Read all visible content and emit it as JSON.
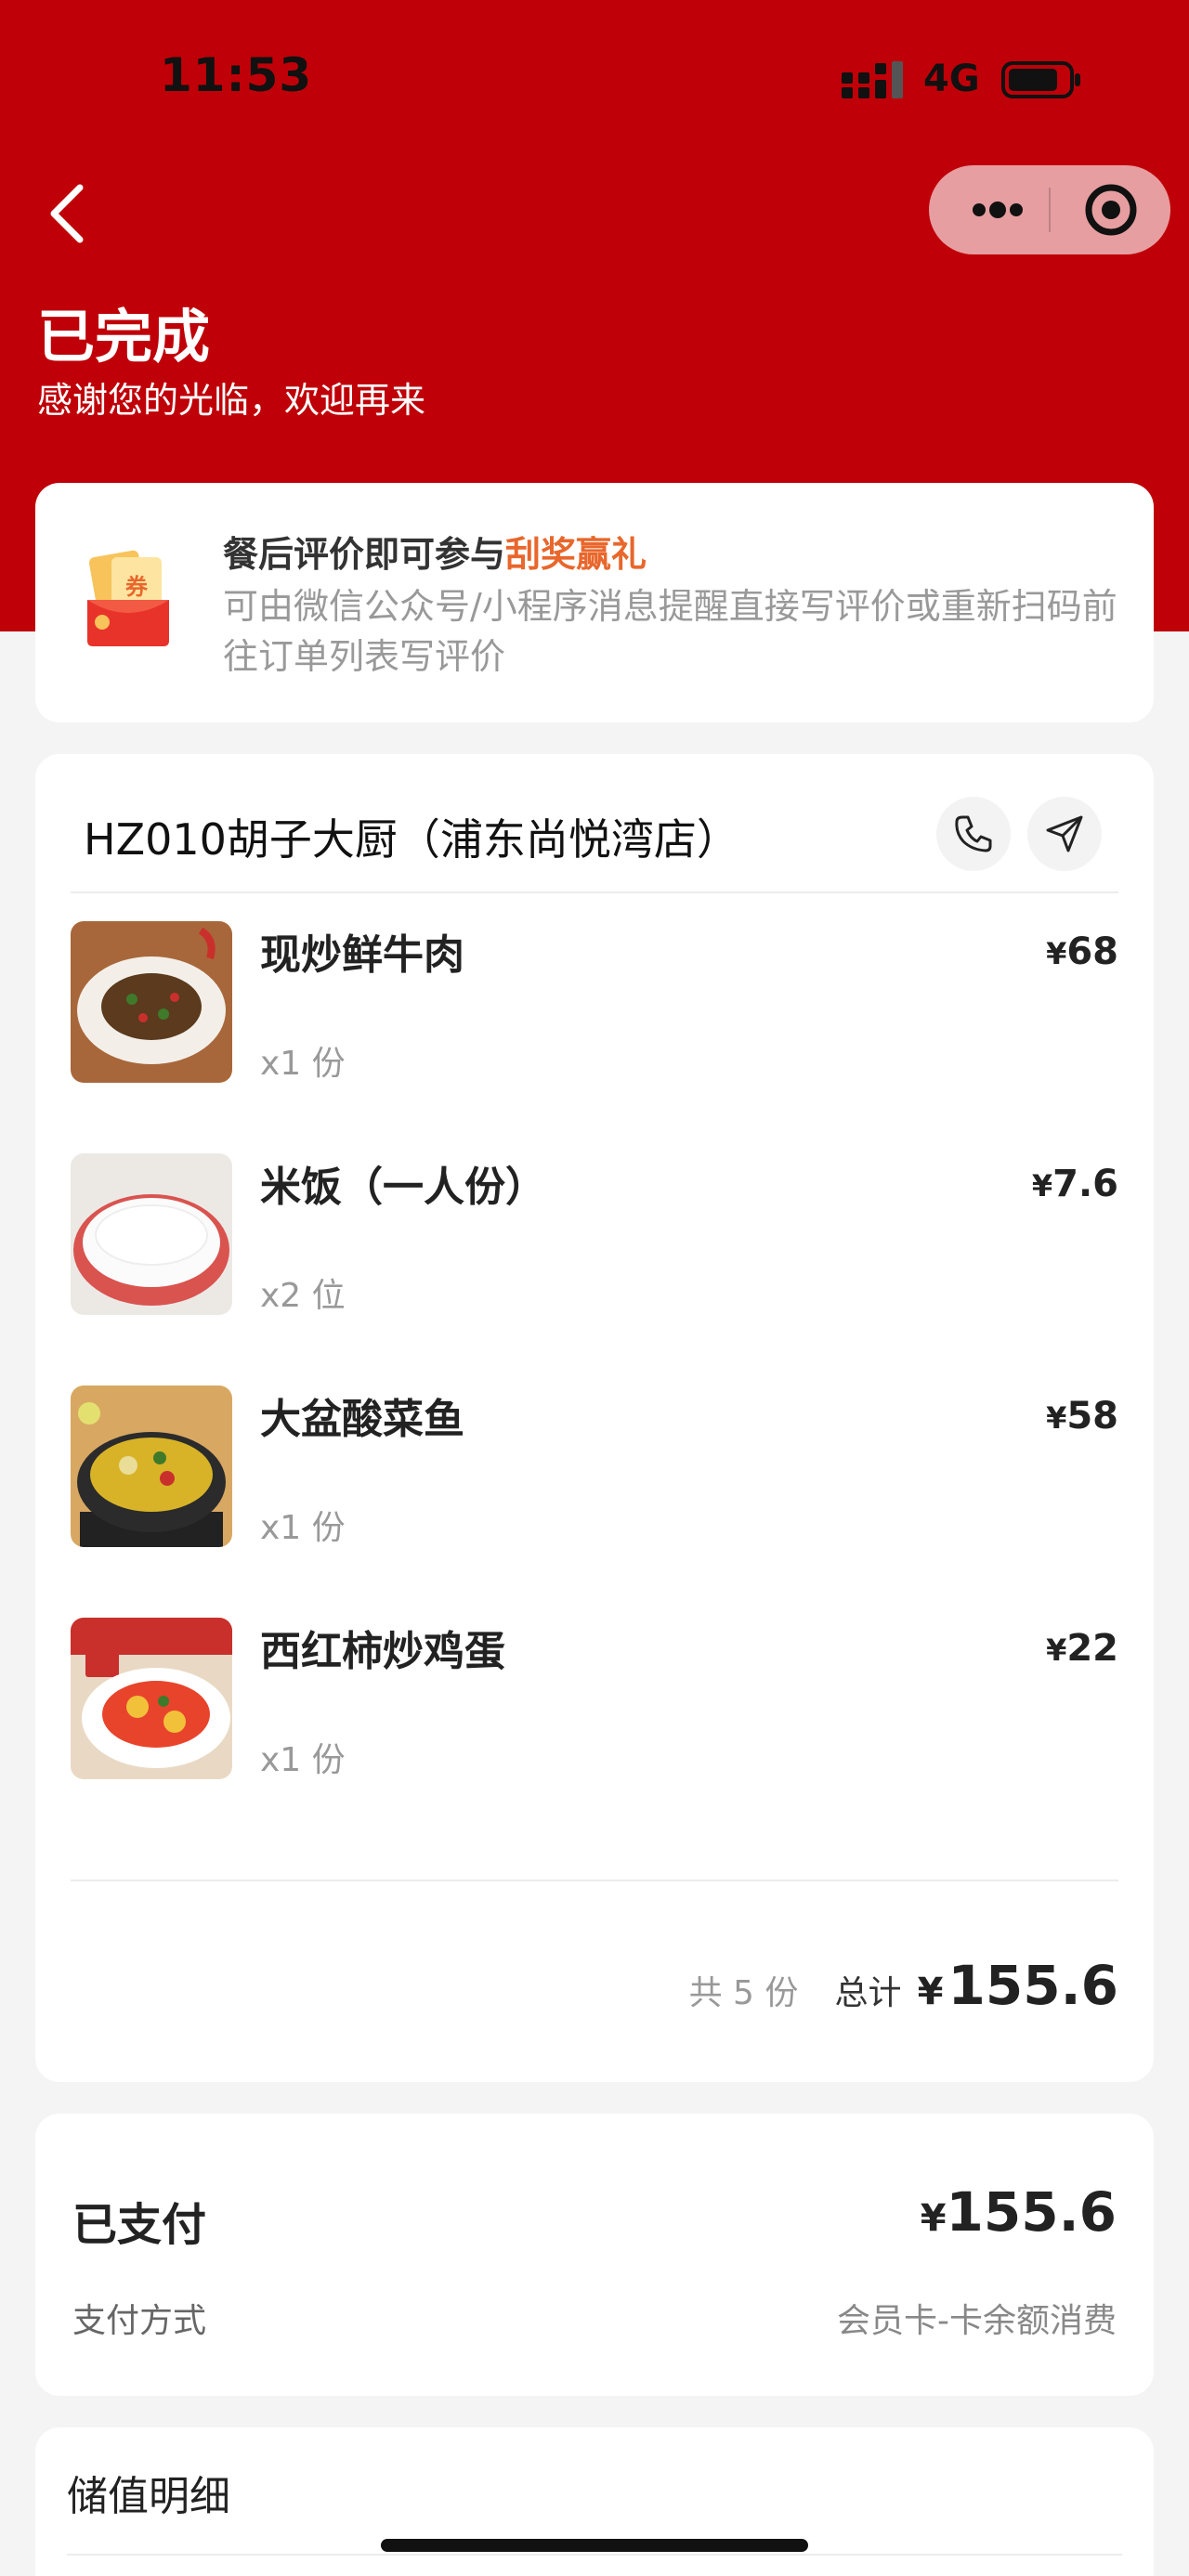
{
  "status_bar": {
    "time": "11:53",
    "network": "4G"
  },
  "colors": {
    "header_red": "#bf0008",
    "accent_orange": "#e8672c"
  },
  "header": {
    "title": "已完成",
    "subtitle": "感谢您的光临，欢迎再来",
    "back_icon": "chevron-left-icon",
    "capsule_icons": [
      "more-dots-icon",
      "target-icon"
    ]
  },
  "promo": {
    "title_prefix": "餐后评价即可参与",
    "title_highlight": "刮奖赢礼",
    "description": "可由微信公众号/小程序消息提醒直接写评价或重新扫码前往订单列表写评价",
    "icon": "coupon-redpacket-icon",
    "icon_text": "券"
  },
  "order": {
    "store_name": "HZ010胡子大厨（浦东尚悦湾店）",
    "actions": [
      "phone-icon",
      "navigation-icon"
    ],
    "items": [
      {
        "name": "现炒鲜牛肉",
        "qty": "x1 份",
        "currency": "¥",
        "price": "68"
      },
      {
        "name": "米饭（一人份）",
        "qty": "x2 位",
        "currency": "¥",
        "price": "7.6"
      },
      {
        "name": "大盆酸菜鱼",
        "qty": "x1 份",
        "currency": "¥",
        "price": "58"
      },
      {
        "name": "西红柿炒鸡蛋",
        "qty": "x1 份",
        "currency": "¥",
        "price": "22"
      }
    ],
    "summary": {
      "count": "共 5 份",
      "total_label": "总计",
      "currency": "¥",
      "total": "155.6"
    }
  },
  "payment": {
    "status_label": "已支付",
    "currency": "¥",
    "amount": "155.6",
    "method_label": "支付方式",
    "method_value": "会员卡-卡余额消费"
  },
  "stored_value": {
    "title": "储值明细"
  }
}
